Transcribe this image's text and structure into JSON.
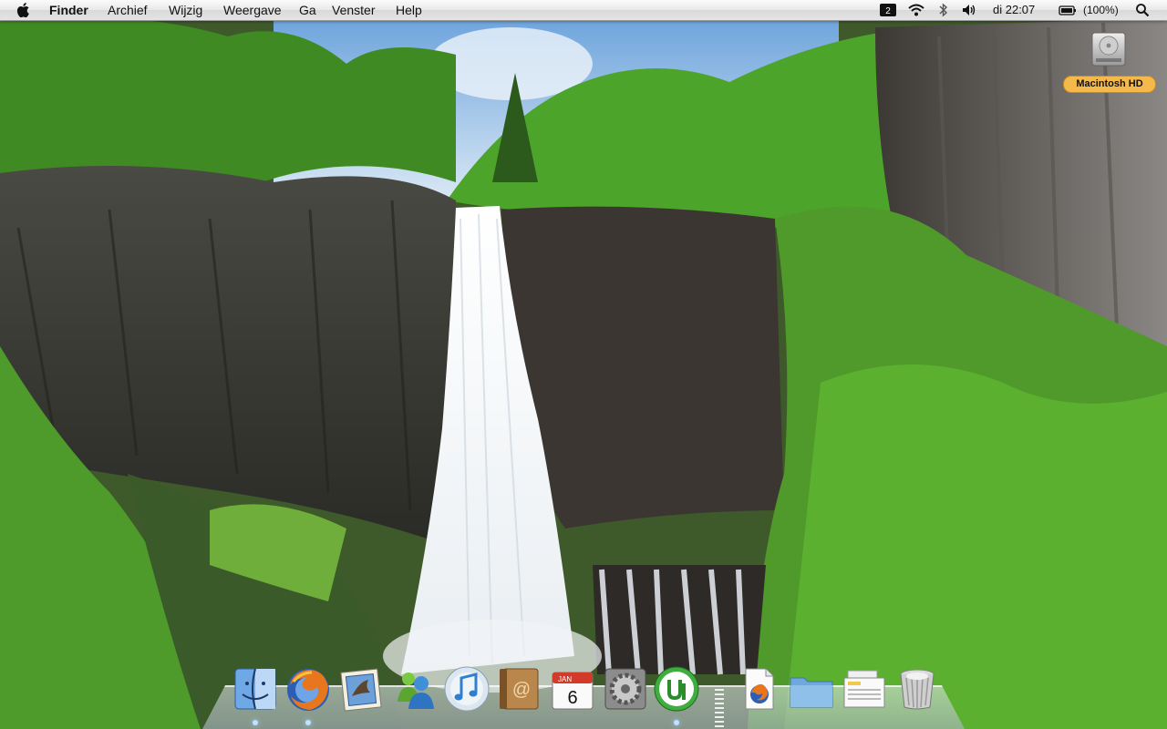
{
  "menubar": {
    "apple_icon": "apple-icon",
    "app_name": "Finder",
    "menus": [
      "Archief",
      "Wijzig",
      "Weergave",
      "Ga",
      "Venster",
      "Help"
    ],
    "status": {
      "time": "di 22:07",
      "battery": "(100%)",
      "icons": [
        "input-menu-icon",
        "wifi-icon",
        "bluetooth-icon",
        "volume-icon",
        "battery-icon",
        "spotlight-icon"
      ]
    }
  },
  "desktop_items": [
    {
      "label": "Macintosh HD",
      "icon": "hard-drive-icon"
    }
  ],
  "calendar_icon": {
    "month": "JAN",
    "day": "6"
  },
  "dock": {
    "apps": [
      "finder-icon",
      "firefox-icon",
      "mail-icon",
      "messenger-icon",
      "itunes-icon",
      "address-book-icon",
      "ical-icon",
      "system-preferences-icon",
      "utorrent-icon"
    ],
    "others": [
      "firefox-document-icon",
      "folder-icon",
      "documents-stack-icon",
      "trash-icon"
    ]
  },
  "colors": {
    "menubar": "#e8e8e8",
    "hd_label_bg": "#f5b84a",
    "dock_glow": "#9dd5ff"
  }
}
